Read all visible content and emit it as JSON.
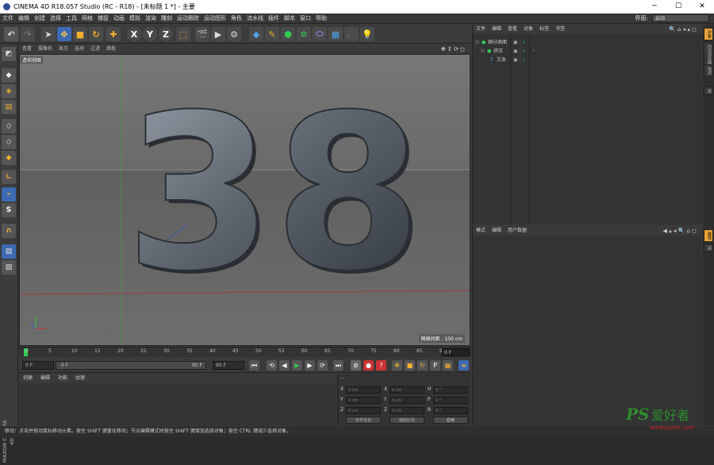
{
  "window": {
    "title": "CINEMA 4D R18.057 Studio (RC - R18) - [未标题 1 *] - 主要",
    "minimize": "─",
    "maximize": "☐",
    "close": "✕"
  },
  "menu": {
    "items": [
      "文件",
      "编辑",
      "创建",
      "选择",
      "工具",
      "网格",
      "捕捉",
      "动画",
      "模拟",
      "渲染",
      "雕刻",
      "运动跟踪",
      "运动图形",
      "角色",
      "流水线",
      "插件",
      "脚本",
      "窗口",
      "帮助"
    ],
    "layout_label": "界面:",
    "layout_value": "启动"
  },
  "viewport": {
    "menu": [
      "查看",
      "摄像机",
      "显示",
      "选项",
      "过滤",
      "面板"
    ],
    "label": "透视视图",
    "grid_info": "网格间距 : 100 cm",
    "text3d": "38"
  },
  "timeline": {
    "ticks": [
      "0",
      "5",
      "10",
      "15",
      "20",
      "25",
      "30",
      "35",
      "40",
      "45",
      "50",
      "55",
      "60",
      "65",
      "70",
      "75",
      "80",
      "85",
      "90"
    ],
    "frame": "0 F"
  },
  "controls": {
    "start": "0 F",
    "preview_start": "0 F",
    "preview_end": "90 F",
    "end": "90 F"
  },
  "material": {
    "menu": [
      "创建",
      "编辑",
      "功能",
      "纹理"
    ]
  },
  "coords": {
    "pos_labels": [
      "X",
      "Y",
      "Z"
    ],
    "size_labels": [
      "X",
      "Y",
      "Z"
    ],
    "rot_labels": [
      "H",
      "P",
      "B"
    ],
    "pos_values": [
      "0 cm",
      "0 cm",
      "0 cm"
    ],
    "size_values": [
      "0 cm",
      "0 cm",
      "0 cm"
    ],
    "rot_values": [
      "0 °",
      "0 °",
      "0 °"
    ],
    "dash": "--",
    "mode1": "世界坐标",
    "mode2": "缩放比例",
    "apply": "应用"
  },
  "objects": {
    "menu": [
      "文件",
      "编辑",
      "查看",
      "对象",
      "标签",
      "书签"
    ],
    "rows": [
      {
        "name": "细分曲面",
        "indent": 1
      },
      {
        "name": "挤压",
        "indent": 2
      },
      {
        "name": "文本",
        "indent": 3
      }
    ]
  },
  "attributes": {
    "menu": [
      "模式",
      "编辑",
      "用户数据"
    ]
  },
  "sidetabs": {
    "top": [
      "对象",
      "内容浏览器",
      "构造",
      "层"
    ],
    "bottom": [
      "属性",
      "层"
    ]
  },
  "status": "移动：点击并拖动鼠标移动元素。按住 SHIFT 键量化移动；节点编辑模式时按住 SHIFT 键增加选择对象；按住 CTRL 键减少选择对象。",
  "maxon": "MAXON CINEMA 4D",
  "watermark": {
    "brand": "PS",
    "cn": "爱好者",
    "url": "www.psahz.com"
  },
  "colors": {
    "accent": "#3d6ab2",
    "active": "#e8a33a",
    "green": "#33cc55"
  }
}
